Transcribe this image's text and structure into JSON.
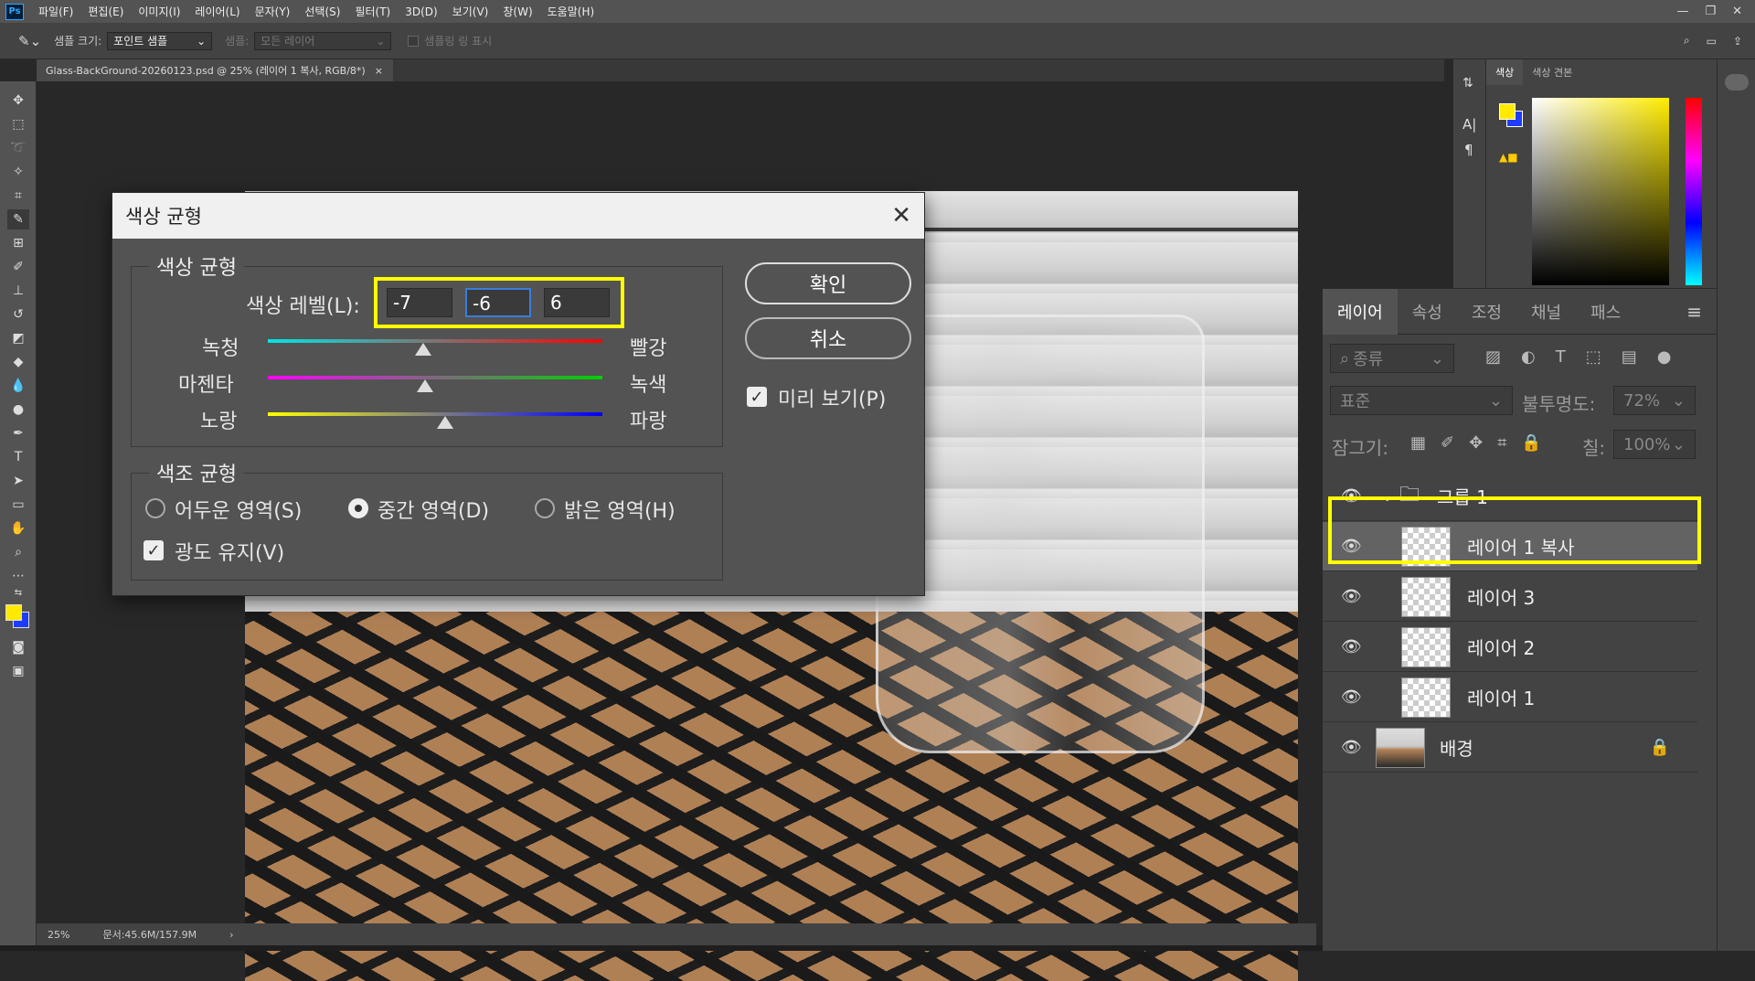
{
  "menu": [
    "파일(F)",
    "편집(E)",
    "이미지(I)",
    "레이어(L)",
    "문자(Y)",
    "선택(S)",
    "필터(T)",
    "3D(D)",
    "보기(V)",
    "창(W)",
    "도움말(H)"
  ],
  "app_logo": "Ps",
  "options": {
    "sample_size_label": "샘플 크기:",
    "sample_size_value": "포인트 샘플",
    "sample_label": "샘플:",
    "sample_value": "모든 레이어",
    "show_ring_label": "샘플링 링 표시"
  },
  "document_tab": {
    "title": "Glass-BackGround-20260123.psd @ 25% (레이어 1 복사, RGB/8*)",
    "close": "×"
  },
  "status": {
    "zoom": "25%",
    "doc_size": "문서:45.6M/157.9M",
    "arrow": "›"
  },
  "color_panel": {
    "tabs": [
      "색상",
      "색상 견본"
    ]
  },
  "colors": {
    "foreground": "#ffea00",
    "background": "#1d3cff",
    "highlight": "#ffff00"
  },
  "layers_panel": {
    "tabs": [
      "레이어",
      "속성",
      "조정",
      "채널",
      "패스"
    ],
    "filter_kind": "종류",
    "blend_mode": "표준",
    "opacity_label": "불투명도:",
    "opacity_value": "72%",
    "lock_label": "잠그기:",
    "fill_label": "칠:",
    "fill_value": "100%",
    "layers": [
      {
        "name": "그룹 1",
        "type": "group"
      },
      {
        "name": "레이어 1 복사",
        "selected": true
      },
      {
        "name": "레이어 3"
      },
      {
        "name": "레이어 2"
      },
      {
        "name": "레이어 1"
      },
      {
        "name": "배경",
        "locked": true
      }
    ]
  },
  "dialog": {
    "title": "색상 균형",
    "section_color_balance": "색상 균형",
    "color_levels_label": "색상 레벨(L):",
    "levels": [
      "-7",
      "-6",
      "6"
    ],
    "sliders": [
      {
        "left": "녹청",
        "right": "빨강",
        "value": -7
      },
      {
        "left": "마젠타",
        "right": "녹색",
        "value": -6
      },
      {
        "left": "노랑",
        "right": "파랑",
        "value": 6
      }
    ],
    "section_tone_balance": "색조 균형",
    "tones": [
      "어두운 영역(S)",
      "중간 영역(D)",
      "밝은 영역(H)"
    ],
    "selected_tone": "중간 영역(D)",
    "preserve_luminosity": "광도 유지(V)",
    "ok": "확인",
    "cancel": "취소",
    "preview": "미리 보기(P)"
  }
}
